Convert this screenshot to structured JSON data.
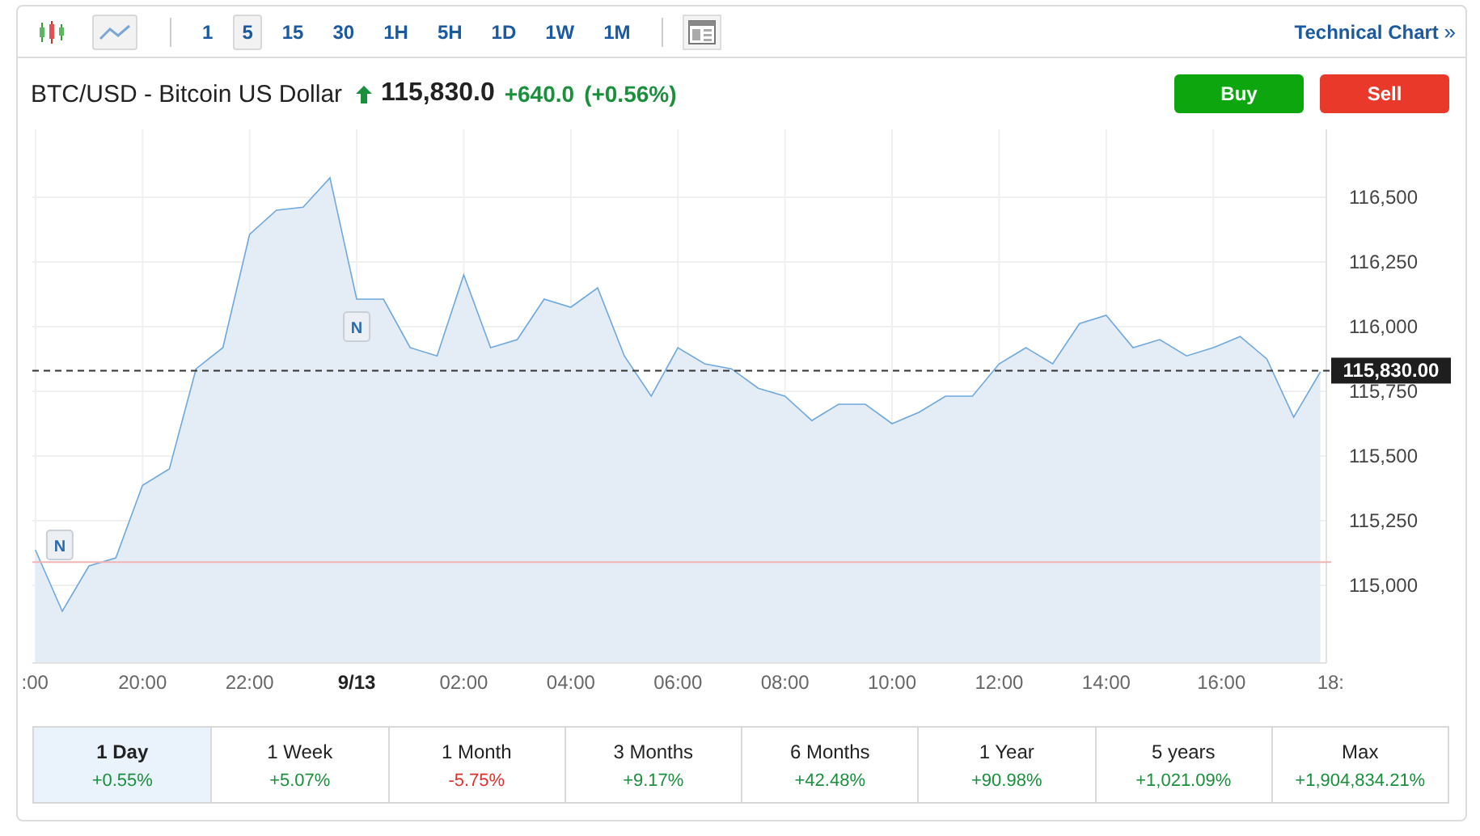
{
  "toolbar": {
    "chart_types": [
      {
        "kind": "candlestick",
        "selected": false
      },
      {
        "kind": "line",
        "selected": true
      }
    ],
    "intervals": [
      {
        "label": "1",
        "selected": false
      },
      {
        "label": "5",
        "selected": true
      },
      {
        "label": "15",
        "selected": false
      },
      {
        "label": "30",
        "selected": false
      },
      {
        "label": "1H",
        "selected": false
      },
      {
        "label": "5H",
        "selected": false
      },
      {
        "label": "1D",
        "selected": false
      },
      {
        "label": "1W",
        "selected": false
      },
      {
        "label": "1M",
        "selected": false
      }
    ],
    "technical_chart_link": {
      "label": "Technical Chart",
      "chevron": "»"
    }
  },
  "header": {
    "title": "BTC/USD - Bitcoin US Dollar",
    "price": "115,830.0",
    "change": "+640.0",
    "change_percent": "(+0.56%)"
  },
  "buttons": [
    {
      "label": "Buy",
      "kind": "buy"
    },
    {
      "label": "Sell",
      "kind": "sell"
    }
  ],
  "chart": {
    "chart_data": {
      "type": "area",
      "categories": [
        ":00",
        null,
        null,
        null,
        "20:00",
        null,
        null,
        null,
        "22:00",
        null,
        null,
        null,
        "9/13",
        null,
        null,
        null,
        "02:00",
        null,
        null,
        null,
        "04:00",
        null,
        null,
        null,
        "06:00",
        null,
        null,
        null,
        "08:00",
        null,
        null,
        null,
        "10:00",
        null,
        null,
        null,
        "12:00",
        null,
        null,
        null,
        "14:00",
        null,
        null,
        null,
        "16:00",
        null,
        null,
        null,
        null
      ],
      "grid": true,
      "series": [
        {
          "color": "#6fa8dc",
          "values": [
            115137,
            114900,
            115075,
            115106,
            115387,
            115450,
            115837,
            115919,
            116356,
            116450,
            116462,
            116575,
            116106,
            116106,
            115919,
            115887,
            116200,
            115919,
            115950,
            116106,
            116075,
            116150,
            115887,
            115731,
            115919,
            115856,
            115837,
            115762,
            115731,
            115637,
            115700,
            115700,
            115625,
            115669,
            115731,
            115731,
            115856,
            115919,
            115856,
            116012,
            116044,
            115919,
            115950,
            115887,
            115919,
            115962,
            115875,
            115650,
            115825
          ]
        }
      ],
      "ylim": [
        114700,
        116762.5
      ],
      "yticks": [
        {
          "value": 115000,
          "label": "115,000"
        },
        {
          "value": 115250,
          "label": "115,250"
        },
        {
          "value": 115500,
          "label": "115,500"
        },
        {
          "value": 115750,
          "label": "115,750"
        },
        {
          "value": 116000,
          "label": "116,000"
        },
        {
          "value": 116250,
          "label": "116,250"
        },
        {
          "value": 116500,
          "label": "116,500"
        }
      ],
      "ref_lines": [
        {
          "axis": "y",
          "value": 115830,
          "label": "115,830.00"
        },
        {
          "axis": "y",
          "value": 115090
        }
      ],
      "annotations": [
        {
          "text": "N",
          "x": ":00",
          "y": 115156
        },
        {
          "text": "N",
          "x": "9/13",
          "y": 116000
        }
      ]
    },
    "axis_edge_label": "18:"
  },
  "periods": [
    {
      "label": "1 Day",
      "change": "+0.55%",
      "color": "#1a8f3c",
      "selected": true
    },
    {
      "label": "1 Week",
      "change": "+5.07%",
      "color": "#1a8f3c",
      "selected": false
    },
    {
      "label": "1 Month",
      "change": "-5.75%",
      "color": "#e0302a",
      "selected": false
    },
    {
      "label": "3 Months",
      "change": "+9.17%",
      "color": "#1a8f3c",
      "selected": false
    },
    {
      "label": "6 Months",
      "change": "+42.48%",
      "color": "#1a8f3c",
      "selected": false
    },
    {
      "label": "1 Year",
      "change": "+90.98%",
      "color": "#1a8f3c",
      "selected": false
    },
    {
      "label": "5 years",
      "change": "+1,021.09%",
      "color": "#1a8f3c",
      "selected": false
    },
    {
      "label": "Max",
      "change": "+1,904,834.21%",
      "color": "#1a8f3c",
      "selected": false
    }
  ]
}
